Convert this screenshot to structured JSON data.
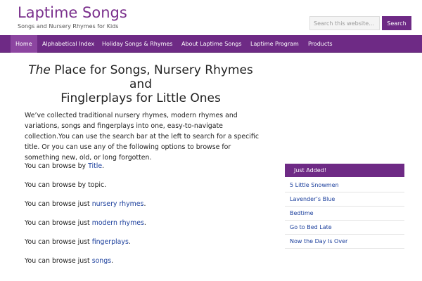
{
  "header": {
    "site_title": "Laptime Songs",
    "site_description": "Songs and Nursery Rhymes for Kids",
    "search_placeholder": "Search this website…",
    "search_button": "Search"
  },
  "nav": {
    "items": [
      {
        "label": "Home",
        "active": true
      },
      {
        "label": "Alphabetical Index"
      },
      {
        "label": "Holiday Songs & Rhymes"
      },
      {
        "label": "About Laptime Songs"
      },
      {
        "label": "Laptime Program"
      },
      {
        "label": "Products"
      }
    ]
  },
  "main": {
    "title_em": "The",
    "title_line1_rest": " Place for Songs, Nursery Rhymes",
    "title_line2": "and",
    "title_line3": "Finglerplays for Little Ones",
    "intro": "We’ve collected traditional nursery rhymes, modern rhymes and variations, songs and fingerplays into one, easy-to-navigate collection.You can use the search bar at the left to search for a specific title. Or you can use any of the following options to browse for something new, old, or long forgotten.",
    "browse": [
      {
        "prefix": "You can browse by ",
        "link": "Title",
        "suffix": "."
      },
      {
        "prefix": "You can browse by topic.",
        "link": "",
        "suffix": ""
      },
      {
        "prefix": "You can browse just ",
        "link": "nursery rhymes",
        "suffix": "."
      },
      {
        "prefix": "You can browse just ",
        "link": "modern rhymes",
        "suffix": "."
      },
      {
        "prefix": "You can browse just ",
        "link": "fingerplays",
        "suffix": "."
      },
      {
        "prefix": "You can browse just ",
        "link": "songs",
        "suffix": "."
      }
    ]
  },
  "sidebar": {
    "header": "Just Added!",
    "items": [
      "5 Little Snowmen",
      "Lavender’s Blue",
      "Bedtime",
      "Go to Bed Late",
      "Now the Day Is Over"
    ]
  },
  "colors": {
    "brand_purple": "#6e2a85",
    "link_blue": "#1a3e9c"
  }
}
